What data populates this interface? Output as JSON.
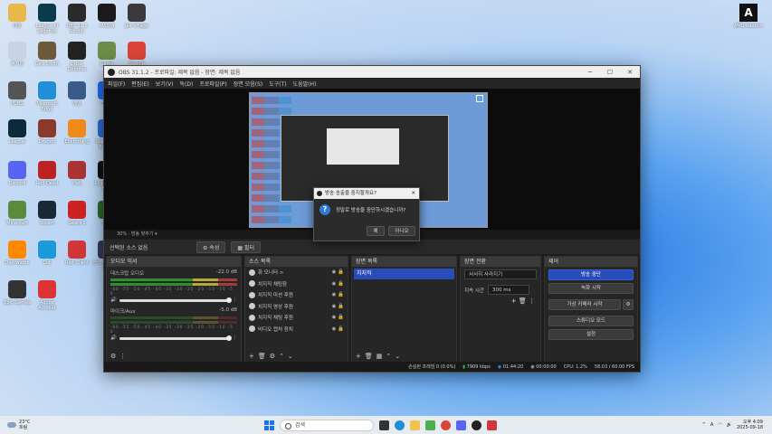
{
  "desktop": {
    "icons": [
      {
        "label": "대충",
        "color": "#e8b84a"
      },
      {
        "label": "League of Legends",
        "color": "#0b3a4c"
      },
      {
        "label": "OBS 31.1 Studio",
        "color": "#2a2a2a"
      },
      {
        "label": "nVIDIA",
        "color": "#1a1a1a"
      },
      {
        "label": "Jak Village",
        "color": "#3a3a3a"
      },
      {
        "label": "휴지통",
        "color": "#c8d4e6"
      },
      {
        "label": "Geo Smith",
        "color": "#6c5a3a"
      },
      {
        "label": "Cyber Defense",
        "color": "#222"
      },
      {
        "label": "Game",
        "color": "#6b8e4a"
      },
      {
        "label": "Google Chrome",
        "color": "#db4437"
      },
      {
        "label": "PUBG",
        "color": "#555"
      },
      {
        "label": "Microsoft Edge",
        "color": "#1f8fd8"
      },
      {
        "label": "메일",
        "color": "#3a5a8a"
      },
      {
        "label": "디스크",
        "color": "#1e6ef0"
      },
      {
        "label": "Riot",
        "color": "#d13639"
      },
      {
        "label": "League",
        "color": "#0d2a3a"
      },
      {
        "label": "Dragon",
        "color": "#8a3a2a"
      },
      {
        "label": "Everything",
        "color": "#f08a1a"
      },
      {
        "label": "Wallpaper Engine",
        "color": "#2a6bd8"
      },
      {
        "label": "Valorant",
        "color": "#222"
      },
      {
        "label": "Discord",
        "color": "#5865f2"
      },
      {
        "label": "Red Dead",
        "color": "#b22"
      },
      {
        "label": "Hell",
        "color": "#a33"
      },
      {
        "label": "Logitech G HUB",
        "color": "#111"
      },
      {
        "label": "Metal Slug",
        "color": "#b33"
      },
      {
        "label": "Minecraft",
        "color": "#5a8a3a"
      },
      {
        "label": "Steam",
        "color": "#1b2838"
      },
      {
        "label": "Gears 5",
        "color": "#c22"
      },
      {
        "label": "Stop",
        "color": "#2a6a2a"
      },
      {
        "label": "Valorant",
        "color": "#e44"
      },
      {
        "label": "Overwatch",
        "color": "#f80"
      },
      {
        "label": "Coll",
        "color": "#1a9ad8"
      },
      {
        "label": "Riot Client",
        "color": "#d13639"
      },
      {
        "label": "클래식 우유 컬렉션",
        "color": "#3a3a5a"
      },
      {
        "label": "OBS Studio",
        "color": "#222"
      },
      {
        "label": "Epic Games",
        "color": "#333"
      },
      {
        "label": "Adobe Acrobat",
        "color": "#d33"
      }
    ],
    "amd_label": "AMD Radeon"
  },
  "obs": {
    "title": "OBS 31.1.2 - 프로파일: 제목 없음 - 장면: 제목 없음",
    "menu": [
      "파일(F)",
      "편집(E)",
      "보기(V)",
      "독(D)",
      "프로파일(P)",
      "장면 모음(S)",
      "도구(T)",
      "도움말(H)"
    ],
    "zoom": "30%",
    "preview_mode": "방송 맞추기",
    "selected_source": "선택된 소스 없음",
    "properties_btn": "속성",
    "filters_btn": "필터",
    "mixer": {
      "title": "오디오 믹서",
      "tracks": [
        {
          "name": "데스크탑 오디오",
          "db": "-22.0 dB"
        },
        {
          "name": "마이크/Aux",
          "db": "-5.0 dB"
        }
      ],
      "scale": "-60 -55 -50 -45 -40 -35 -30 -25 -20 -15 -10 -5 0"
    },
    "sources": {
      "title": "소스 목록",
      "items": [
        "화 모니터 >",
        "치지직 채팅창",
        "치지직 미션 후원",
        "치지직 영상 후원",
        "치지직 채팅 후원",
        "비디오 캡처 장치"
      ]
    },
    "scenes": {
      "title": "장면 목록",
      "items": [
        "치지직"
      ]
    },
    "transitions": {
      "title": "장면 전환",
      "type": "서서히 사라지기",
      "duration_label": "지속 시간",
      "duration": "300 ms"
    },
    "controls": {
      "title": "제어",
      "buttons": [
        "방송 중단",
        "녹화 시작",
        "가상 카메라 시작",
        "스튜디오 모드",
        "설정"
      ]
    },
    "status": {
      "dropped": "손실된 프레임 0 (0.0%)",
      "bitrate": "7909 kbps",
      "live": "01:44:20",
      "rec": "00:00:00",
      "cpu": "CPU: 1.2%",
      "fps": "58.03 / 60.00 FPS"
    }
  },
  "dialog": {
    "title": "방송 송출을 중지할까요?",
    "message": "정말로 방송을 중단하시겠습니까?",
    "yes": "예",
    "no": "아니오"
  },
  "taskbar": {
    "temp": "23°C",
    "weather": "흐림",
    "search": "검색",
    "time": "오후 4:09",
    "date": "2025-09-18"
  }
}
